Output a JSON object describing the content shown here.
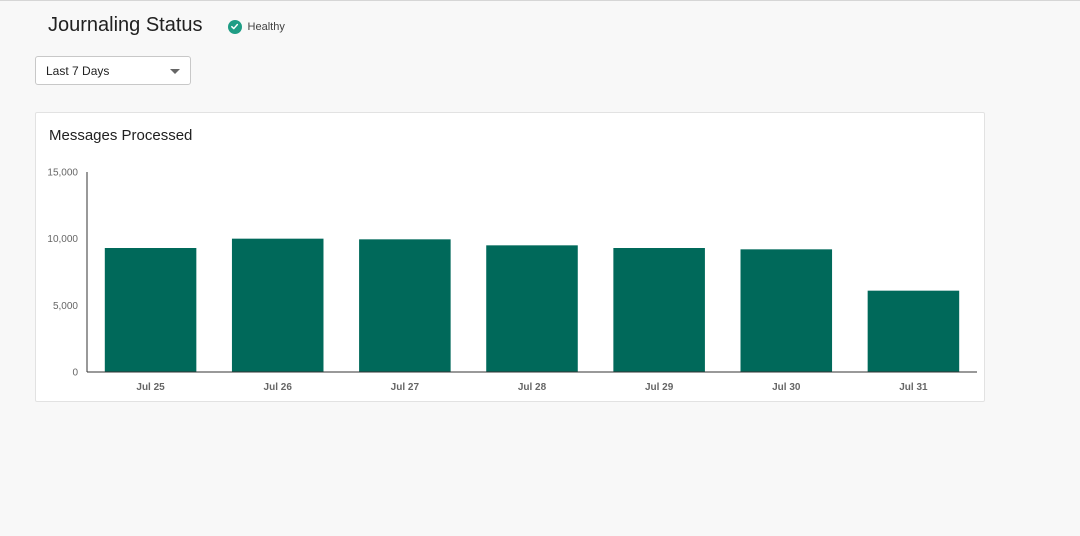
{
  "header": {
    "title": "Journaling Status",
    "status_label": "Healthy",
    "status_icon": "check-circle-icon",
    "status_color": "#1f9d85"
  },
  "filter": {
    "selected": "Last 7 Days",
    "icon": "caret-down-icon"
  },
  "card": {
    "title": "Messages Processed"
  },
  "chart_data": {
    "type": "bar",
    "title": "Messages Processed",
    "categories": [
      "Jul 25",
      "Jul 26",
      "Jul 27",
      "Jul 28",
      "Jul 29",
      "Jul 30",
      "Jul 31"
    ],
    "values": [
      9300,
      10000,
      9950,
      9500,
      9300,
      9200,
      6100
    ],
    "ylim": [
      0,
      15000
    ],
    "yticks": [
      0,
      5000,
      10000,
      15000
    ],
    "ytick_labels": [
      "0",
      "5,000",
      "10,000",
      "15,000"
    ],
    "xlabel": "",
    "ylabel": "",
    "grid": false,
    "legend": "none",
    "bar_color": "#00695a"
  }
}
